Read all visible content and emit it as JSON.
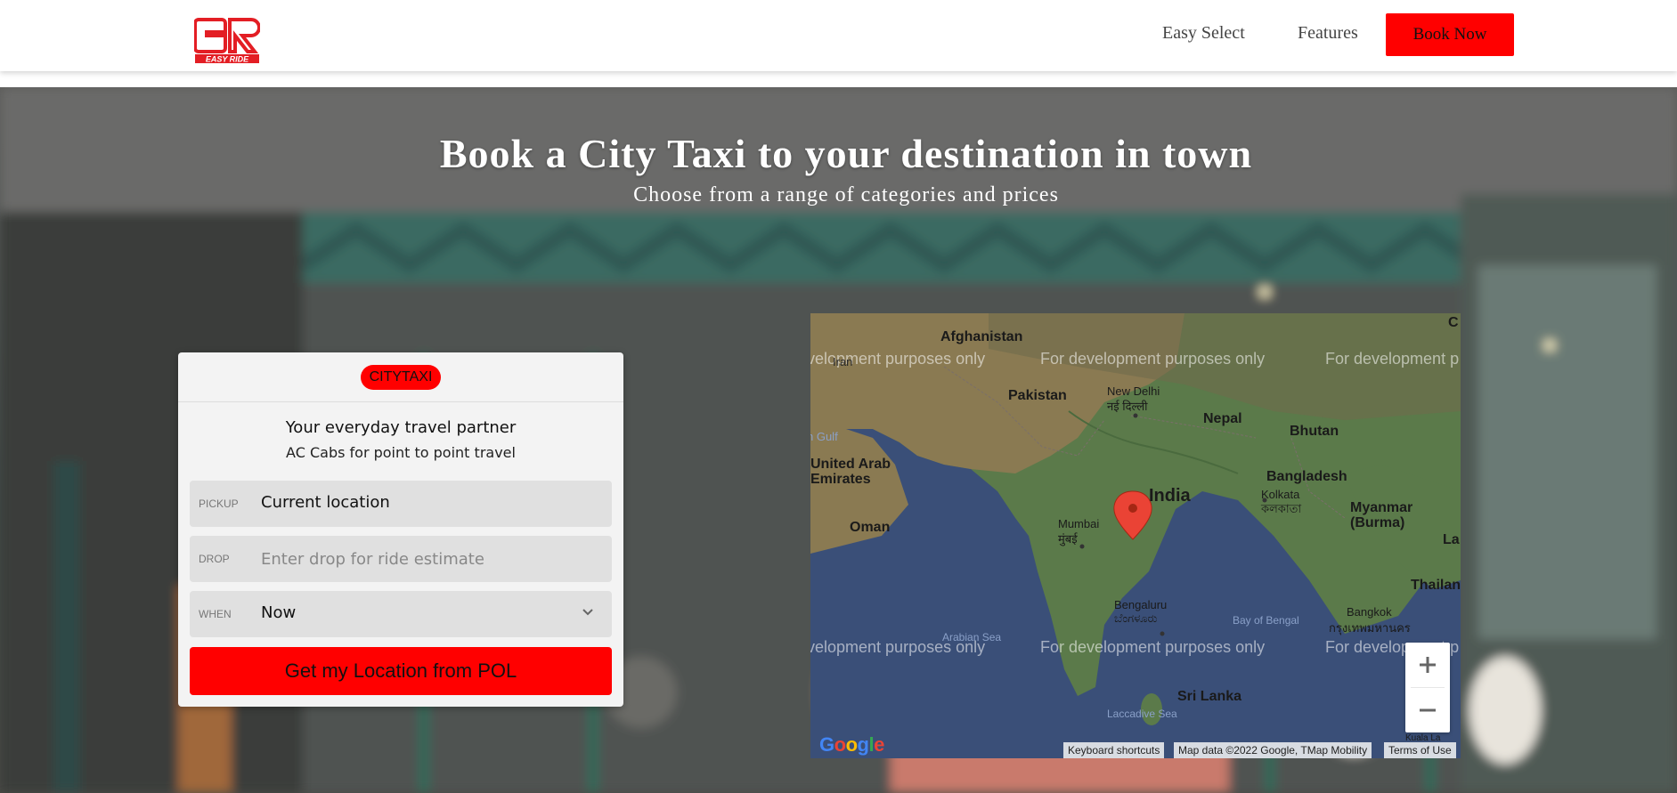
{
  "nav": {
    "logo_text": "EASY RIDE",
    "easy_select": "Easy Select",
    "features": "Features",
    "book_now": "Book Now"
  },
  "hero": {
    "title": "Book a City Taxi to your destination in town",
    "subtitle": "Choose from a range of categories and prices"
  },
  "booking": {
    "category": "CITYTAXI",
    "title": "Your everyday travel partner",
    "description": "AC Cabs for point to point travel",
    "pickup": {
      "label": "PICKUP",
      "value": "Current location"
    },
    "drop": {
      "label": "DROP",
      "placeholder": "Enter drop for ride estimate"
    },
    "when": {
      "label": "WHEN",
      "value": "Now"
    },
    "cta": "Get my Location from POL"
  },
  "map": {
    "watermark": "For development purposes only",
    "watermark_clipped_left": "velopment purposes only",
    "watermark_clipped_right": "For development p",
    "labels": {
      "afghanistan": "Afghanistan",
      "pakistan": "Pakistan",
      "new_delhi": "New Delhi",
      "new_delhi_local": "नई दिल्ली",
      "nepal": "Nepal",
      "bhutan": "Bhutan",
      "uae": "United Arab\nEmirates",
      "oman": "Oman",
      "india": "India",
      "mumbai": "Mumbai",
      "mumbai_local": "मुंबई",
      "kolkata": "Kolkata",
      "kolkata_local": "কলকাতা",
      "bangladesh": "Bangladesh",
      "myanmar": "Myanmar\n(Burma)",
      "bengaluru": "Bengaluru",
      "bengaluru_local": "ಬೆಂಗಳೂರು",
      "arabian_sea": "Arabian Sea",
      "bay_of_bengal": "Bay of Bengal",
      "sri_lanka": "Sri Lanka",
      "laccadive_sea": "Laccadive Sea",
      "thailand": "Thailan",
      "bangkok": "Bangkok",
      "bangkok_local": "กรุงเทพมหานคร",
      "gulf": "n Gulf",
      "iran": "Iran",
      "lao": "La",
      "c": "C",
      "kuala": "Kuala La"
    },
    "google": "Google",
    "keyboard_shortcuts": "Keyboard shortcuts",
    "map_data": "Map data ©2022 Google, TMap Mobility",
    "terms": "Terms of Use"
  },
  "colors": {
    "brand": "#ff0000",
    "land": "#5a7a4a",
    "water": "#3a4f78"
  }
}
